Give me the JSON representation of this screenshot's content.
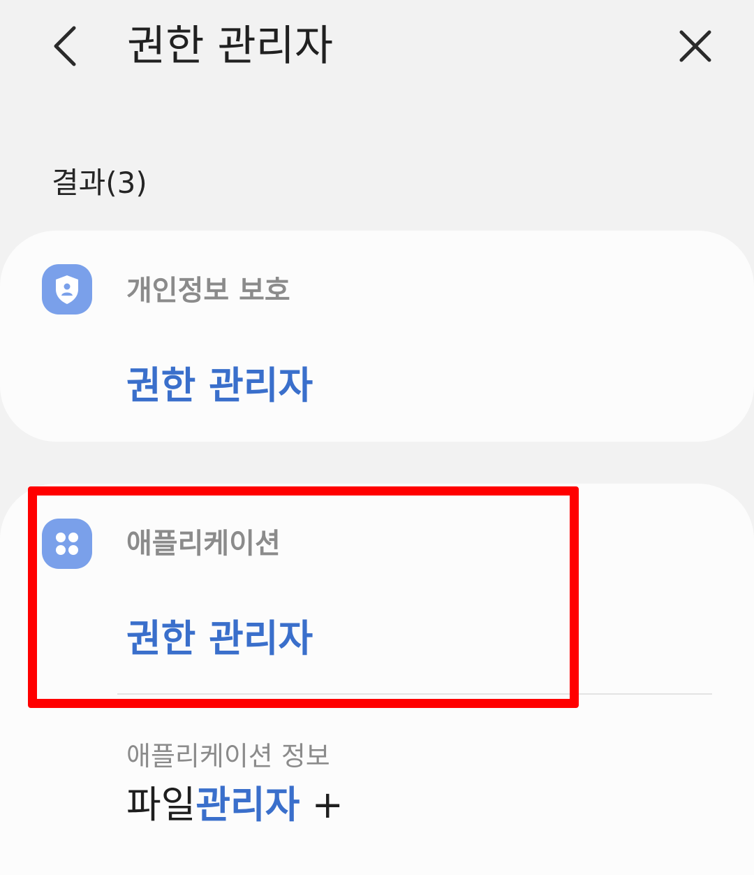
{
  "header": {
    "title": "권한 관리자",
    "back_icon": "chevron-left-icon",
    "close_icon": "close-icon"
  },
  "results": {
    "count_label": "결과(3)"
  },
  "cards": [
    {
      "icon": "shield-person-icon",
      "category": "개인정보 보호",
      "title": "권한 관리자"
    },
    {
      "icon": "apps-grid-icon",
      "category": "애플리케이션",
      "title": "권한 관리자",
      "sub_item": {
        "category": "애플리케이션 정보",
        "title_prefix": "파일",
        "title_highlight": "관리자",
        "title_suffix": " +"
      }
    }
  ],
  "colors": {
    "background": "#f2f2f2",
    "card": "#fcfcfc",
    "accent": "#3a6fcb",
    "icon_bg": "#7aa0ea",
    "highlight_border": "#ff0000"
  }
}
